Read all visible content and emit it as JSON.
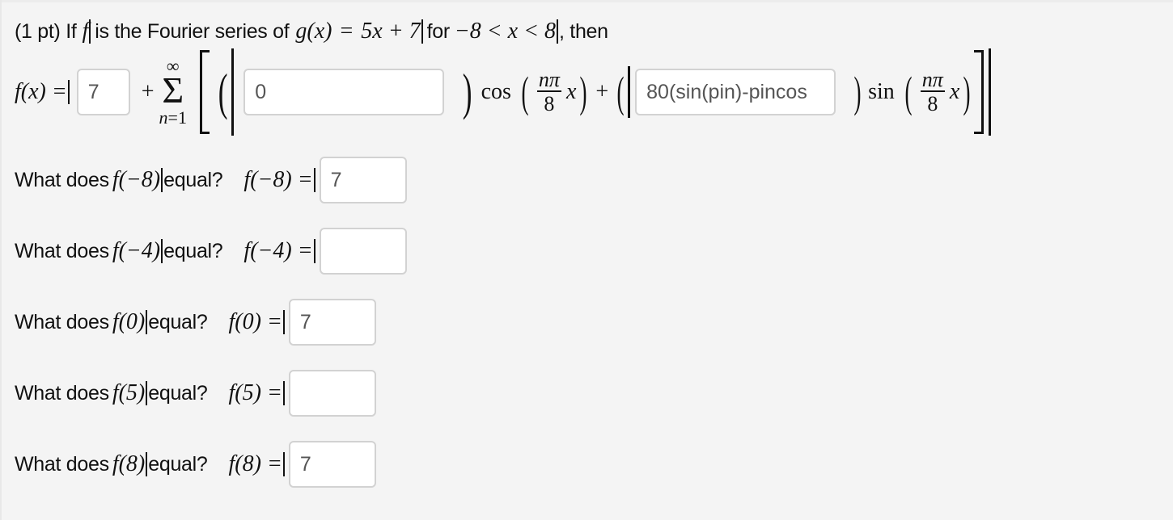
{
  "problem": {
    "points": "(1 pt) If",
    "func_name": "f",
    "is_fourier": "is the Fourier series of",
    "g_lhs": "g(x)",
    "g_eq": "=",
    "g_rhs": "5x + 7",
    "for_text": "for",
    "interval": "−8 < x < 8",
    "then_text": ", then"
  },
  "series": {
    "lhs": "f(x) =",
    "a0_value": "7",
    "plus": "+",
    "sum_upper": "∞",
    "sum_symbol": "Σ",
    "sum_lower_var": "n",
    "sum_lower_rest": "=1",
    "an_value": "0",
    "cos_label": "cos",
    "frac_num": "nπ",
    "frac_den": "8",
    "x_var": "x",
    "plus2": "+",
    "bn_value": "80(sin(pin)-pincos",
    "sin_label": "sin"
  },
  "questions": [
    {
      "prefix": "What does",
      "arg": "f(−8)",
      "suffix": "equal?",
      "lhs": "f(−8) =",
      "value": "7"
    },
    {
      "prefix": "What does",
      "arg": "f(−4)",
      "suffix": "equal?",
      "lhs": "f(−4) =",
      "value": ""
    },
    {
      "prefix": "What does",
      "arg": "f(0)",
      "suffix": "equal?",
      "lhs": "f(0) =",
      "value": "7"
    },
    {
      "prefix": "What does",
      "arg": "f(5)",
      "suffix": "equal?",
      "lhs": "f(5) =",
      "value": ""
    },
    {
      "prefix": "What does",
      "arg": "f(8)",
      "suffix": "equal?",
      "lhs": "f(8) =",
      "value": "7"
    }
  ]
}
